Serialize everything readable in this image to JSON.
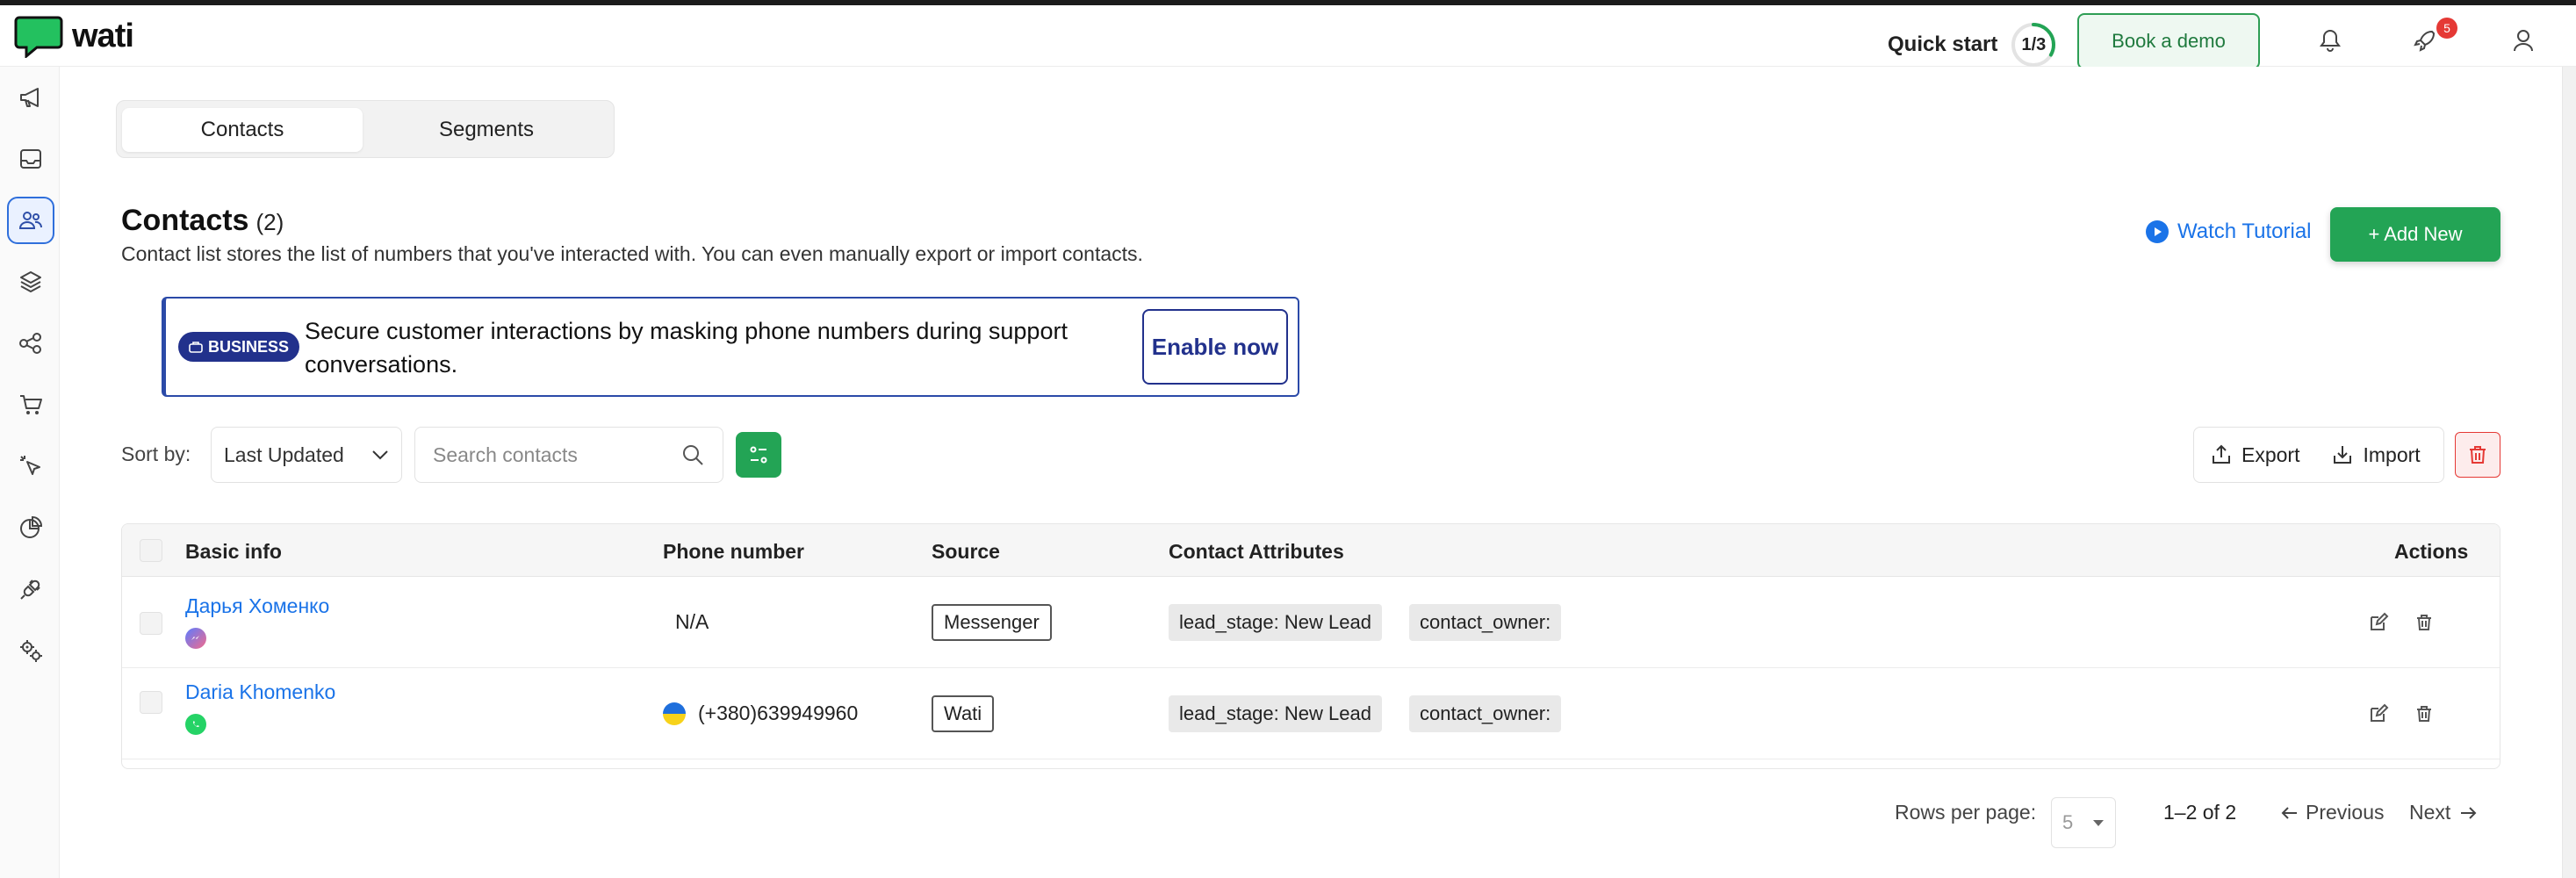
{
  "brand": {
    "name": "wati",
    "accent": "#23a455"
  },
  "topbar": {
    "quick_start_label": "Quick start",
    "quick_start_progress": "1/3",
    "quick_start_fraction": 0.333,
    "book_demo_label": "Book a demo",
    "notifications_badge": "5"
  },
  "sidebar": {
    "items": [
      {
        "name": "broadcast",
        "icon": "megaphone-icon",
        "active": false
      },
      {
        "name": "inbox",
        "icon": "inbox-icon",
        "active": false
      },
      {
        "name": "contacts",
        "icon": "users-icon",
        "active": true
      },
      {
        "name": "automations",
        "icon": "layers-icon",
        "active": false
      },
      {
        "name": "flows",
        "icon": "share-nodes-icon",
        "active": false
      },
      {
        "name": "commerce",
        "icon": "cart-icon",
        "active": false
      },
      {
        "name": "ads",
        "icon": "click-icon",
        "active": false
      },
      {
        "name": "analytics",
        "icon": "pie-chart-icon",
        "active": false
      },
      {
        "name": "integrations",
        "icon": "plug-icon",
        "active": false
      },
      {
        "name": "settings",
        "icon": "gears-icon",
        "active": false
      }
    ]
  },
  "tabs": [
    {
      "label": "Contacts",
      "active": true
    },
    {
      "label": "Segments",
      "active": false
    }
  ],
  "page": {
    "title": "Contacts",
    "count": "(2)",
    "subtitle": "Contact list stores the list of numbers that you've interacted with. You can even manually export or import contacts.",
    "watch_tutorial": "Watch Tutorial",
    "add_new": "+ Add New"
  },
  "banner": {
    "badge": "BUSINESS",
    "text": "Secure customer interactions by masking phone numbers during support conversations.",
    "button": "Enable now"
  },
  "toolbar": {
    "sort_label": "Sort by:",
    "sort_value": "Last Updated",
    "search_placeholder": "Search contacts",
    "export_label": "Export",
    "import_label": "Import"
  },
  "table": {
    "columns": [
      "Basic info",
      "Phone number",
      "Source",
      "Contact Attributes",
      "Actions"
    ],
    "rows": [
      {
        "name": "Дарья Хоменко",
        "channel_icon": "messenger-icon",
        "phone": "N/A",
        "has_flag": false,
        "source": "Messenger",
        "attributes": [
          "lead_stage: New Lead",
          "contact_owner:"
        ]
      },
      {
        "name": "Daria Khomenko",
        "channel_icon": "whatsapp-icon",
        "phone": "(+380)639949960",
        "has_flag": true,
        "source": "Wati",
        "attributes": [
          "lead_stage: New Lead",
          "contact_owner:"
        ]
      }
    ]
  },
  "pagination": {
    "rows_per_page_label": "Rows per page:",
    "rows_per_page_value": "5",
    "range": "1–2 of 2",
    "previous": "Previous",
    "next": "Next"
  }
}
